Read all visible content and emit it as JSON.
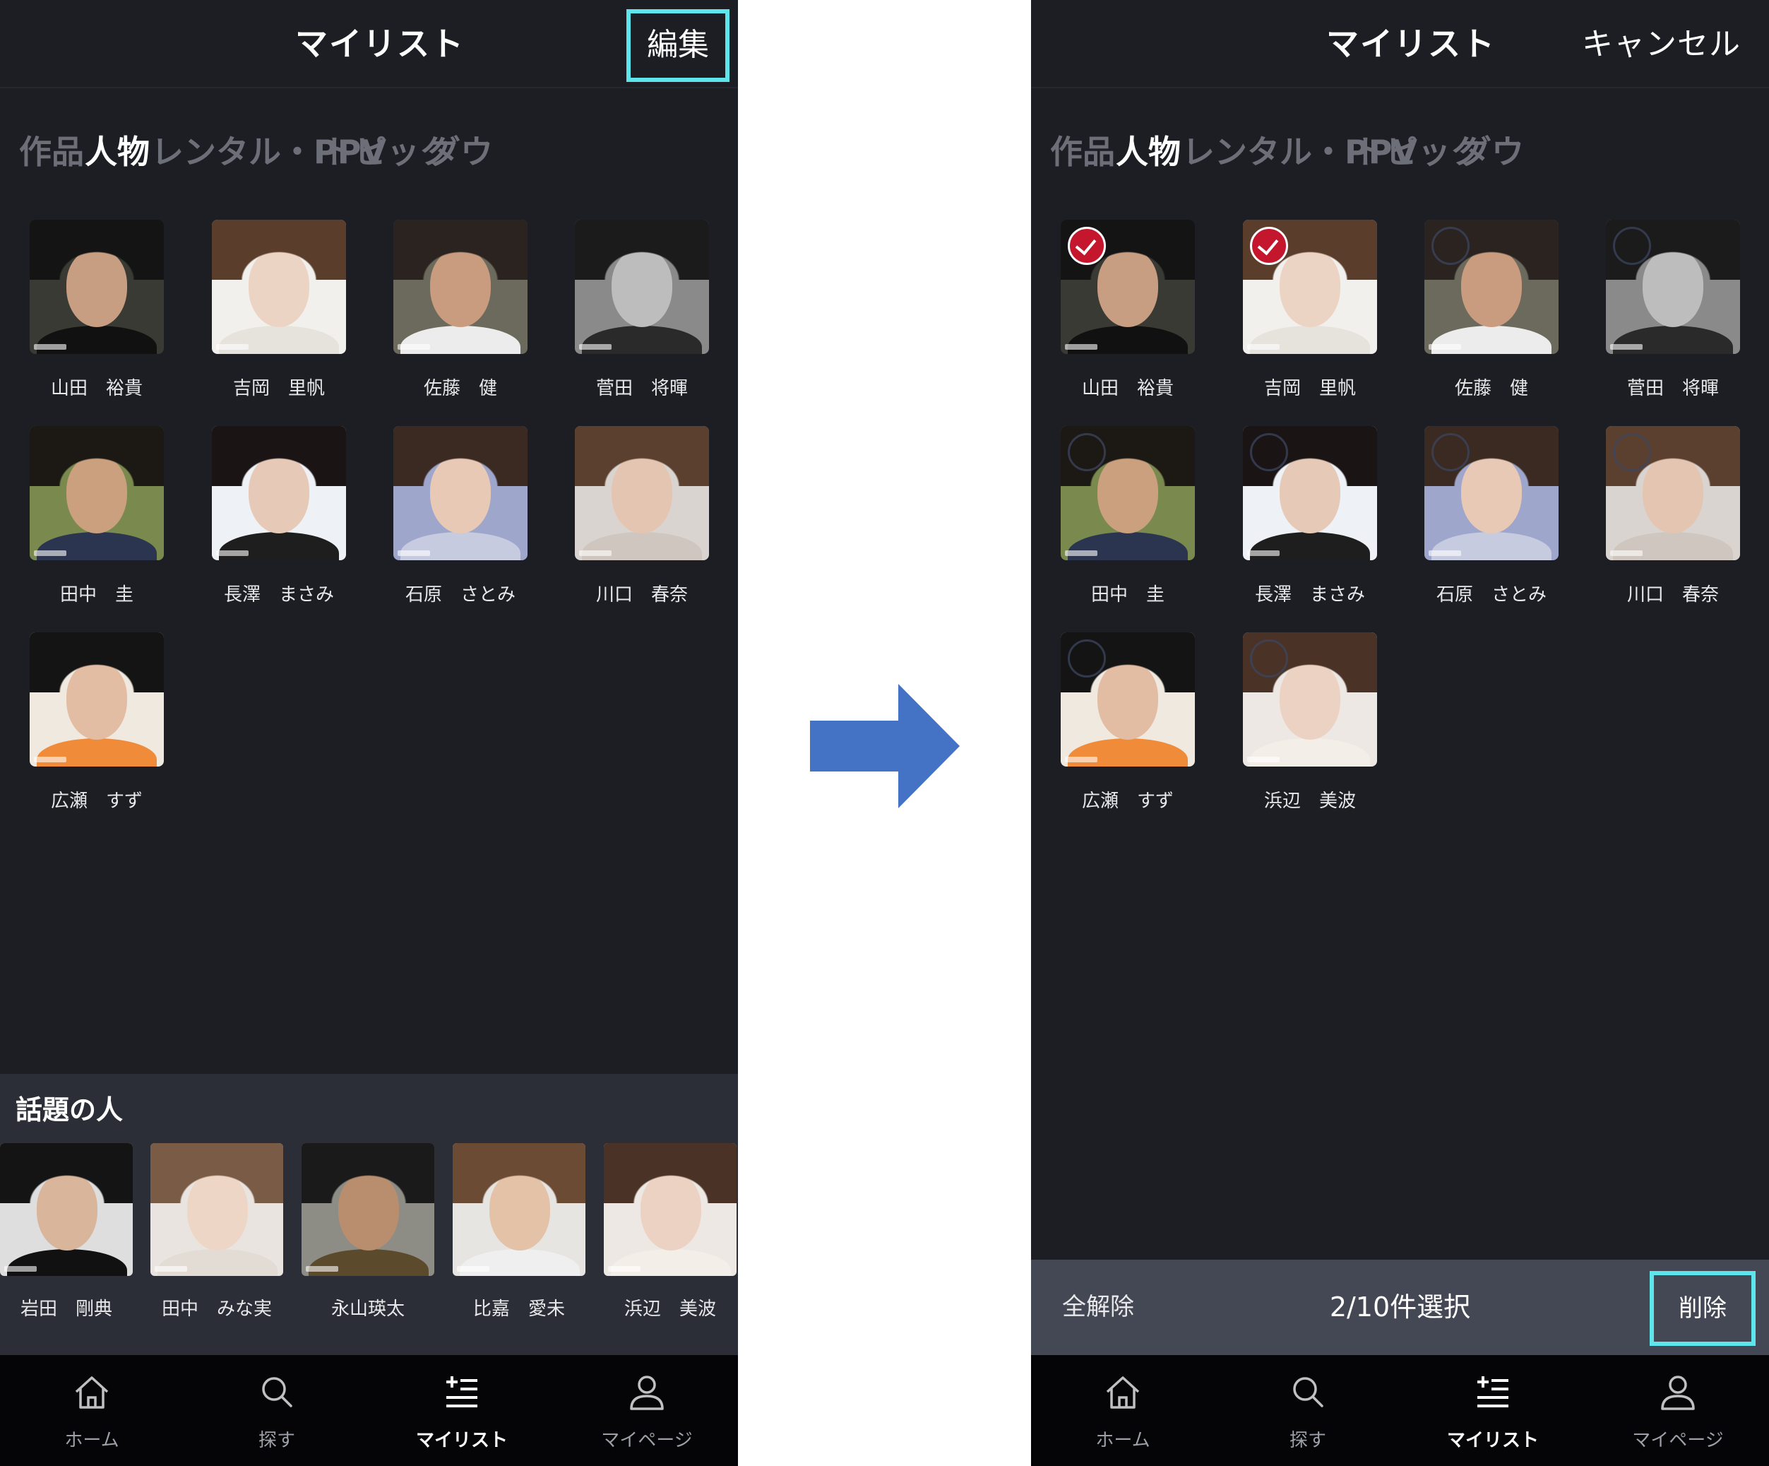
{
  "left_screen": {
    "header": {
      "title": "マイリスト",
      "edit_label": "編集"
    },
    "tabs": [
      "作品",
      "人物",
      "レンタル・PPV",
      "トピック",
      "ダウ"
    ],
    "active_tab": "人物",
    "people": [
      {
        "name": "山田　裕貴"
      },
      {
        "name": "吉岡　里帆"
      },
      {
        "name": "佐藤　健"
      },
      {
        "name": "菅田　将暉"
      },
      {
        "name": "田中　圭"
      },
      {
        "name": "長澤　まさみ"
      },
      {
        "name": "石原　さとみ"
      },
      {
        "name": "川口　春奈"
      },
      {
        "name": "広瀬　すず"
      }
    ],
    "trending": {
      "title": "話題の人",
      "people": [
        {
          "name": "岩田　剛典"
        },
        {
          "name": "田中　みな実"
        },
        {
          "name": "永山瑛太"
        },
        {
          "name": "比嘉　愛未"
        },
        {
          "name": "浜辺　美波"
        }
      ]
    }
  },
  "right_screen": {
    "header": {
      "title": "マイリスト",
      "cancel_label": "キャンセル"
    },
    "tabs": [
      "作品",
      "人物",
      "レンタル・PPV",
      "トピック",
      "ダウ"
    ],
    "active_tab": "人物",
    "people": [
      {
        "name": "山田　裕貴",
        "selected": true
      },
      {
        "name": "吉岡　里帆",
        "selected": true
      },
      {
        "name": "佐藤　健",
        "selected": false
      },
      {
        "name": "菅田　将暉",
        "selected": false
      },
      {
        "name": "田中　圭",
        "selected": false
      },
      {
        "name": "長澤　まさみ",
        "selected": false
      },
      {
        "name": "石原　さとみ",
        "selected": false
      },
      {
        "name": "川口　春奈",
        "selected": false
      },
      {
        "name": "広瀬　すず",
        "selected": false
      },
      {
        "name": "浜辺　美波",
        "selected": false
      }
    ],
    "selection_bar": {
      "clear_label": "全解除",
      "count_label": "2/10件選択",
      "delete_label": "削除"
    }
  },
  "nav": [
    {
      "label": "ホーム",
      "icon": "home-icon"
    },
    {
      "label": "探す",
      "icon": "search-icon"
    },
    {
      "label": "マイリスト",
      "icon": "mylist-icon",
      "active": true
    },
    {
      "label": "マイページ",
      "icon": "profile-icon"
    }
  ],
  "colors": {
    "background": "#1c1e24",
    "highlight_box": "#5ee5ec",
    "check_red": "#c4172d",
    "arrow_blue": "#4472c4",
    "selection_bar": "#434854"
  }
}
